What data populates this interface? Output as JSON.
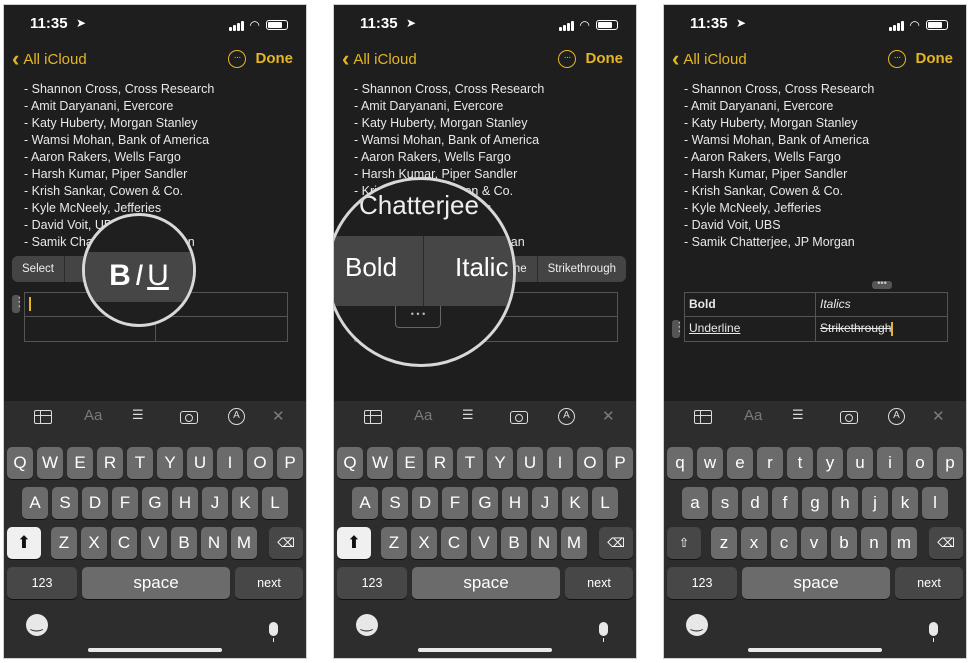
{
  "status": {
    "time": "11:35"
  },
  "nav": {
    "back_label": "All iCloud",
    "done_label": "Done",
    "more_glyph": "···"
  },
  "notes_lines": [
    "- Shannon Cross, Cross Research",
    "- Amit Daryanani, Evercore",
    "- Katy Huberty, Morgan Stanley",
    "- Wamsi Mohan, Bank of America",
    "- Aaron Rakers, Wells Fargo",
    "- Harsh Kumar, Piper Sandler",
    "- Krish Sankar, Cowen & Co.",
    "- Kyle McNeely, Jefferies",
    "- David Voit, UBS",
    "- Samik Chatterjee, JP Morgan"
  ],
  "panel1": {
    "menu_select": "Select",
    "zoom_bold": "B",
    "zoom_italic": "I",
    "zoom_underline": "U"
  },
  "panel2": {
    "zoom_text_top": "Chatterjee",
    "zoom_bold": "Bold",
    "zoom_italic": "Italic",
    "menu_fragment": "ne",
    "menu_strike": "Strikethrough",
    "zoom_handle": "• • •"
  },
  "panel3": {
    "table": [
      [
        "Bold",
        "Italics"
      ],
      [
        "Underline",
        "Strikethrough"
      ]
    ],
    "col_handle": "•••"
  },
  "toolbar": {
    "format_label": "Aa",
    "close_label": "✕"
  },
  "keyboard_upper": {
    "row1": [
      "Q",
      "W",
      "E",
      "R",
      "T",
      "Y",
      "U",
      "I",
      "O",
      "P"
    ],
    "row2": [
      "A",
      "S",
      "D",
      "F",
      "G",
      "H",
      "J",
      "K",
      "L"
    ],
    "row3": [
      "Z",
      "X",
      "C",
      "V",
      "B",
      "N",
      "M"
    ]
  },
  "keyboard_lower": {
    "row1": [
      "q",
      "w",
      "e",
      "r",
      "t",
      "y",
      "u",
      "i",
      "o",
      "p"
    ],
    "row2": [
      "a",
      "s",
      "d",
      "f",
      "g",
      "h",
      "j",
      "k",
      "l"
    ],
    "row3": [
      "z",
      "x",
      "c",
      "v",
      "b",
      "n",
      "m"
    ]
  },
  "keys": {
    "numbers": "123",
    "space": "space",
    "next": "next",
    "shift": "⬆",
    "shift_outline": "⇧",
    "delete": "⌫"
  },
  "colors": {
    "accent": "#e5b623",
    "background": "#1e1e1e",
    "key": "#6b6b6b"
  }
}
